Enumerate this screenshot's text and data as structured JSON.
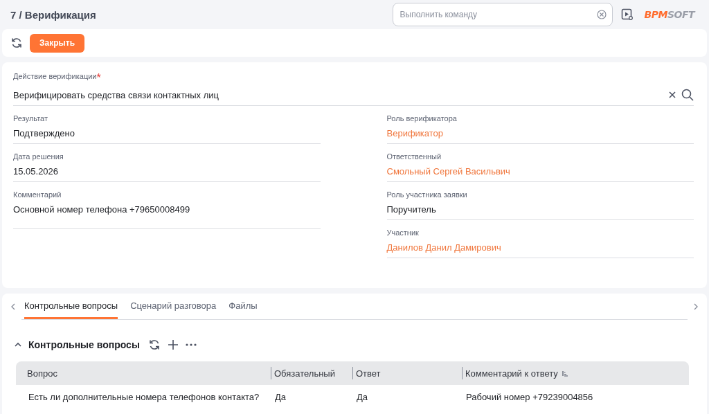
{
  "header": {
    "title": "7 / Верификация",
    "command_placeholder": "Выполнить команду",
    "logo": {
      "primary": "BPM",
      "secondary": "SOFT"
    }
  },
  "toolbar": {
    "close_button": "Закрыть"
  },
  "main_field": {
    "label": "Действие верификации",
    "required_mark": "*",
    "value": "Верифицировать средства связи контактных лиц"
  },
  "left_fields": [
    {
      "label": "Результат",
      "value": "Подтверждено",
      "link": false,
      "tall": false
    },
    {
      "label": "Дата решения",
      "value": "15.05.2026",
      "link": false,
      "tall": false
    },
    {
      "label": "Комментарий",
      "value": "Основной номер телефона +79650008499",
      "link": false,
      "tall": true
    }
  ],
  "right_fields": [
    {
      "label": "Роль верификатора",
      "value": "Верификатор",
      "link": true,
      "tall": false
    },
    {
      "label": "Ответственный",
      "value": "Смольный Сергей Васильвич",
      "link": true,
      "tall": false
    },
    {
      "label": "Роль участника заявки",
      "value": "Поручитель",
      "link": false,
      "tall": false
    },
    {
      "label": "Участник",
      "value": "Данилов Данил Дамирович",
      "link": true,
      "tall": false
    }
  ],
  "tabs": [
    {
      "label": "Контрольные вопросы",
      "selected": true
    },
    {
      "label": "Сценарий разговора",
      "selected": false
    },
    {
      "label": "Файлы",
      "selected": false
    }
  ],
  "detail": {
    "title": "Контрольные вопросы",
    "expanded": true,
    "columns": [
      "Вопрос",
      "Обязательный",
      "Ответ",
      "Комментарий к ответу"
    ],
    "rows": [
      [
        "Есть ли дополнительные номера телефонов контакта?",
        "Да",
        "Да",
        "Рабочий номер +79239004856"
      ]
    ]
  }
}
